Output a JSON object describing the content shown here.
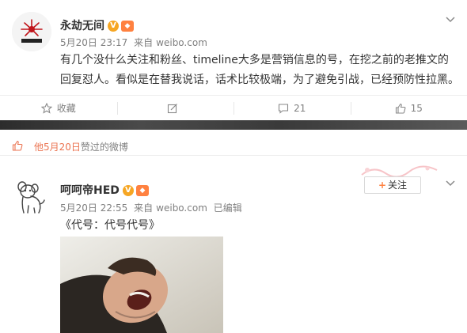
{
  "post1": {
    "username": "永劫无间",
    "v_badge": "V",
    "date": "5月20日 23:17",
    "source_prefix": "来自",
    "source": "weibo.com",
    "text": "有几个没什么关注和粉丝、timeline大多是营销信息的号，在挖之前的老推文的回复怼人。看似是在替我说话，话术比较极端，为了避免引战，已经预防性拉黑。",
    "actions": {
      "favorite": "收藏",
      "repost": "",
      "comments": "21",
      "likes": "15"
    }
  },
  "liked_bar": {
    "who": "他5月20日",
    "what": "赞过的微博"
  },
  "post2": {
    "username": "呵呵帝HED",
    "v_badge": "V",
    "follow_label": "关注",
    "date": "5月20日 22:55",
    "source_prefix": "来自",
    "source": "weibo.com",
    "edited": "已编辑",
    "text": "《代号：代号代号》"
  },
  "colors": {
    "accent_orange": "#ff8140",
    "liked_text": "#eb7350",
    "meta_gray": "#808080"
  }
}
